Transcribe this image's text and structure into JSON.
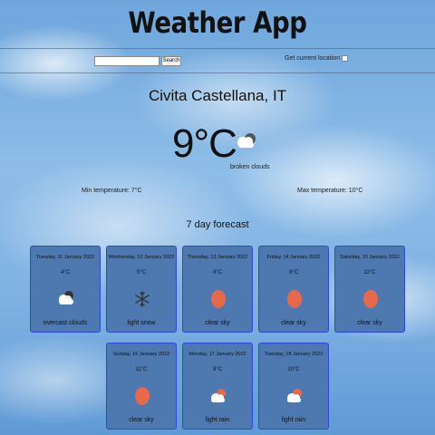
{
  "app": {
    "title": "Weather App"
  },
  "toolbar": {
    "search_placeholder": "",
    "search_value": "",
    "search_label": "Search",
    "current_location_label": "Get current location"
  },
  "current": {
    "city": "Civita Castellana, IT",
    "temperature": "9°C",
    "condition": "broken clouds",
    "icon": "broken-clouds-icon",
    "min_temp": "Min temperature: 7°C",
    "max_temp": "Max temperature: 10°C"
  },
  "forecast": {
    "title": "7 day forecast",
    "days": [
      {
        "day": "Tuesday, 11 January 2022",
        "temp": "4°C",
        "desc": "overcast clouds",
        "icon": "overcast-clouds-icon"
      },
      {
        "day": "Wednesday, 12 January 2022",
        "temp": "5°C",
        "desc": "light snow",
        "icon": "snowflake-icon"
      },
      {
        "day": "Thursday, 13 January 2022",
        "temp": "8°C",
        "desc": "clear sky",
        "icon": "sun-icon"
      },
      {
        "day": "Friday, 14 January 2022",
        "temp": "8°C",
        "desc": "clear sky",
        "icon": "sun-icon"
      },
      {
        "day": "Saturday, 15 January 2022",
        "temp": "11°C",
        "desc": "clear sky",
        "icon": "sun-icon"
      },
      {
        "day": "Sunday, 16 January 2022",
        "temp": "11°C",
        "desc": "clear sky",
        "icon": "sun-icon"
      },
      {
        "day": "Monday, 17 January 2022",
        "temp": "9°C",
        "desc": "light rain",
        "icon": "light-rain-icon"
      },
      {
        "day": "Tuesday, 18 January 2022",
        "temp": "10°C",
        "desc": "light rain",
        "icon": "light-rain-icon"
      }
    ]
  },
  "colors": {
    "card_bg": "#4d79b0",
    "card_border": "#2f47d8",
    "sun": "#e8684a"
  }
}
